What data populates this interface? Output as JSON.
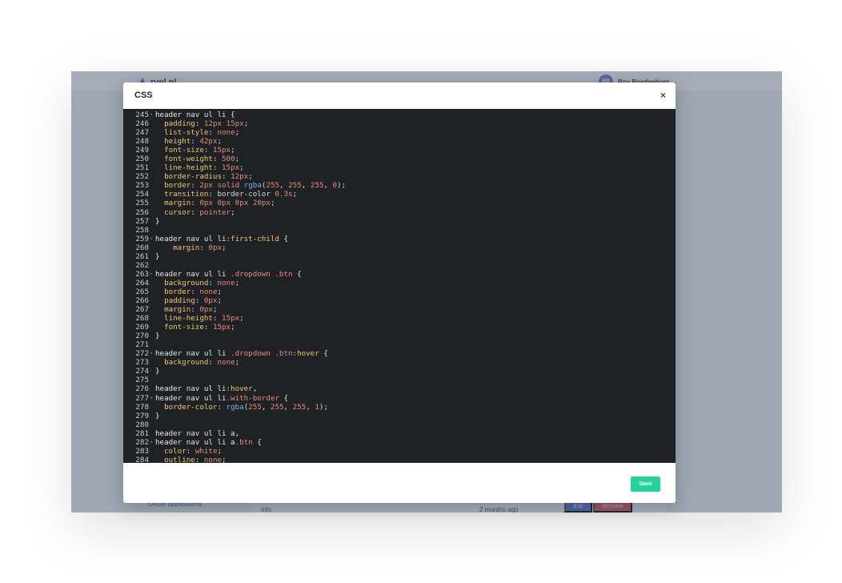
{
  "background_app": {
    "brand": "rvel.nl",
    "user_initials": "RB",
    "user_name": "Roy Boedenburg ⌄",
    "sidebar_link": "OAuth applications",
    "row_label": "Info",
    "row_time": "2 months ago",
    "edit_label": "Edit",
    "remove_label": "Remove"
  },
  "modal": {
    "title": "CSS",
    "close_label": "×",
    "save_label": "Save"
  },
  "colors": {
    "editor_bg": "#1f2125",
    "save_button": "#27d19b",
    "overlay": "rgba(70,84,108,0.48)"
  },
  "editor": {
    "lines": [
      {
        "n": "245",
        "fold": true,
        "text": "header nav ul li {"
      },
      {
        "n": "246",
        "fold": false,
        "text": "  padding: 12px 15px;"
      },
      {
        "n": "247",
        "fold": false,
        "text": "  list-style: none;"
      },
      {
        "n": "248",
        "fold": false,
        "text": "  height: 42px;"
      },
      {
        "n": "249",
        "fold": false,
        "text": "  font-size: 15px;"
      },
      {
        "n": "250",
        "fold": false,
        "text": "  font-weight: 500;"
      },
      {
        "n": "251",
        "fold": false,
        "text": "  line-height: 15px;"
      },
      {
        "n": "252",
        "fold": false,
        "text": "  border-radius: 12px;"
      },
      {
        "n": "253",
        "fold": false,
        "text": "  border: 2px solid rgba(255, 255, 255, 0);"
      },
      {
        "n": "254",
        "fold": false,
        "text": "  transition: border-color 0.3s;"
      },
      {
        "n": "255",
        "fold": false,
        "text": "  margin: 0px 0px 0px 20px;"
      },
      {
        "n": "256",
        "fold": false,
        "text": "  cursor: pointer;"
      },
      {
        "n": "257",
        "fold": false,
        "text": "}"
      },
      {
        "n": "258",
        "fold": false,
        "text": ""
      },
      {
        "n": "259",
        "fold": true,
        "text": "header nav ul li:first-child {"
      },
      {
        "n": "260",
        "fold": false,
        "text": "    margin: 0px;"
      },
      {
        "n": "261",
        "fold": false,
        "text": "}"
      },
      {
        "n": "262",
        "fold": false,
        "text": ""
      },
      {
        "n": "263",
        "fold": true,
        "text": "header nav ul li .dropdown .btn {"
      },
      {
        "n": "264",
        "fold": false,
        "text": "  background: none;"
      },
      {
        "n": "265",
        "fold": false,
        "text": "  border: none;"
      },
      {
        "n": "266",
        "fold": false,
        "text": "  padding: 0px;"
      },
      {
        "n": "267",
        "fold": false,
        "text": "  margin: 0px;"
      },
      {
        "n": "268",
        "fold": false,
        "text": "  line-height: 15px;"
      },
      {
        "n": "269",
        "fold": false,
        "text": "  font-size: 15px;"
      },
      {
        "n": "270",
        "fold": false,
        "text": "}"
      },
      {
        "n": "271",
        "fold": false,
        "text": ""
      },
      {
        "n": "272",
        "fold": true,
        "text": "header nav ul li .dropdown .btn:hover {"
      },
      {
        "n": "273",
        "fold": false,
        "text": "  background: none;"
      },
      {
        "n": "274",
        "fold": false,
        "text": "}"
      },
      {
        "n": "275",
        "fold": false,
        "text": ""
      },
      {
        "n": "276",
        "fold": false,
        "text": "header nav ul li:hover,"
      },
      {
        "n": "277",
        "fold": true,
        "text": "header nav ul li.with-border {"
      },
      {
        "n": "278",
        "fold": false,
        "text": "  border-color: rgba(255, 255, 255, 1);"
      },
      {
        "n": "279",
        "fold": false,
        "text": "}"
      },
      {
        "n": "280",
        "fold": false,
        "text": ""
      },
      {
        "n": "281",
        "fold": false,
        "text": "header nav ul li a,"
      },
      {
        "n": "282",
        "fold": true,
        "text": "header nav ul li a.btn {"
      },
      {
        "n": "283",
        "fold": false,
        "text": "  color: white;"
      },
      {
        "n": "284",
        "fold": false,
        "text": "  outline: none;"
      }
    ]
  }
}
